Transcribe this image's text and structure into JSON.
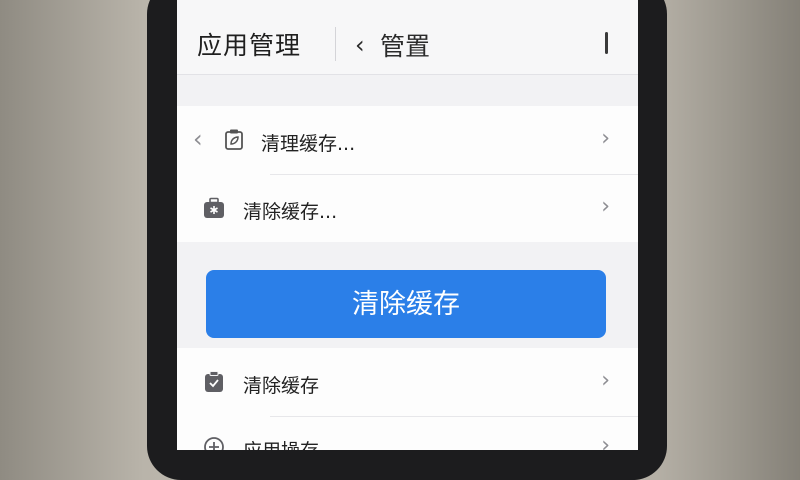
{
  "header": {
    "title": "应用管理",
    "back_icon": "chevron-left-icon",
    "subtitle": "管置"
  },
  "rows": [
    {
      "label": "清理缓存...",
      "icon": "clipboard-leaf-icon",
      "leading": "chevron-left-icon",
      "trailing": "chevron-right-icon"
    },
    {
      "label": "清除缓存...",
      "icon": "medical-case-icon",
      "trailing": "chevron-right-icon"
    },
    {
      "label": "清除缓存",
      "icon": "clipboard-check-icon",
      "trailing": "chevron-right-icon"
    },
    {
      "label": "应用操存",
      "icon": "plus-circle-icon",
      "trailing": "chevron-right-icon"
    }
  ],
  "primary_button": {
    "label": "清除缓存",
    "color": "#2b7fe8"
  },
  "colors": {
    "screen_bg": "#f2f2f4",
    "card_bg": "#fdfdfd",
    "chevron": "#8d8d92"
  }
}
